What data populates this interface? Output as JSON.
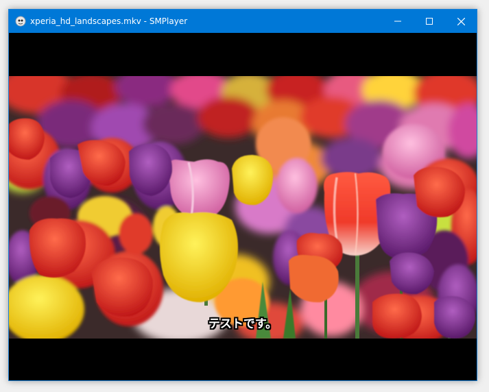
{
  "window": {
    "title": "xperia_hd_landscapes.mkv - SMPlayer",
    "app_icon": "smplayer-icon",
    "controls": [
      "minimize-icon",
      "maximize-icon",
      "close-icon"
    ],
    "titlebar_color": "#0078d7"
  },
  "player": {
    "subtitle": "テストです。",
    "video_frame": "tulip-field-image"
  }
}
